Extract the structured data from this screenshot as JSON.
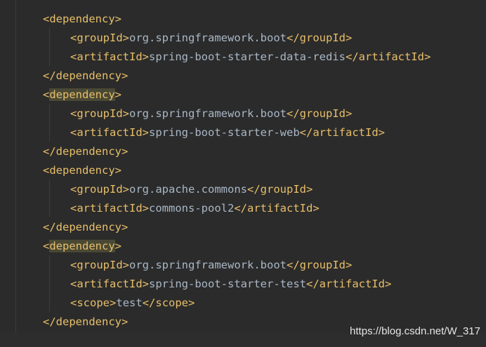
{
  "lines": [
    {
      "open": "dependency"
    },
    {
      "tag": "groupId",
      "text": "org.springframework.boot"
    },
    {
      "tag": "artifactId",
      "text": "spring-boot-starter-data-redis"
    },
    {
      "close": "dependency"
    },
    {
      "open": "dependency",
      "highlight": true
    },
    {
      "tag": "groupId",
      "text": "org.springframework.boot"
    },
    {
      "tag": "artifactId",
      "text": "spring-boot-starter-web"
    },
    {
      "close": "dependency"
    },
    {
      "open": "dependency"
    },
    {
      "tag": "groupId",
      "text": "org.apache.commons"
    },
    {
      "tag": "artifactId",
      "text": "commons-pool2"
    },
    {
      "close": "dependency"
    },
    {
      "open": "dependency",
      "highlight": true
    },
    {
      "tag": "groupId",
      "text": "org.springframework.boot"
    },
    {
      "tag": "artifactId",
      "text": "spring-boot-starter-test"
    },
    {
      "tag": "scope",
      "text": "test"
    },
    {
      "close": "dependency"
    }
  ],
  "watermark": "https://blog.csdn.net/W_317",
  "colors": {
    "background": "#2b2b2b",
    "tag": "#e8bf6a",
    "text": "#a9b7c6",
    "highlight": "#4a4935"
  }
}
